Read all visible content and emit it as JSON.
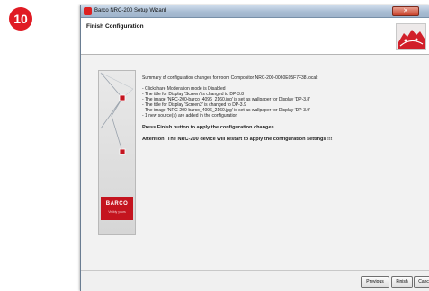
{
  "step_number": "10",
  "window": {
    "title": "Barco NRC-200 Setup Wizard",
    "close_glyph": "✕"
  },
  "header": {
    "title": "Finish Configuration"
  },
  "sidebar": {
    "brand": "BARCO",
    "tagline": "Visibly yours"
  },
  "content": {
    "summary": "Summary of configuration changes for room Compositor NRC-200-0060E05F7F38.local:",
    "changes": [
      "- Clickshare Moderation mode is Disabled",
      "- The title for Display 'Screen' is changed to DP-3.8",
      "- The image 'NRC-200-barco_4096_2160.jpg' is set as wallpaper for Display 'DP-3.8'",
      "- The title for Display 'Screen2' is changed to DP-3.9",
      "- The image 'NRC-200-barco_4096_2160.jpg' is set as wallpaper for Display 'DP-3.9'",
      "- 1 new source(s) are added in the configuration"
    ],
    "press_finish": "Press Finish button to apply the configuration changes.",
    "attention": "Attention: The NRC-200 device will restart to apply the configuration settings !!!"
  },
  "buttons": {
    "previous": "Previous",
    "finish": "Finish",
    "cancel": "Cancel"
  },
  "colors": {
    "badge": "#e01b24",
    "brand_red": "#c4141f"
  }
}
